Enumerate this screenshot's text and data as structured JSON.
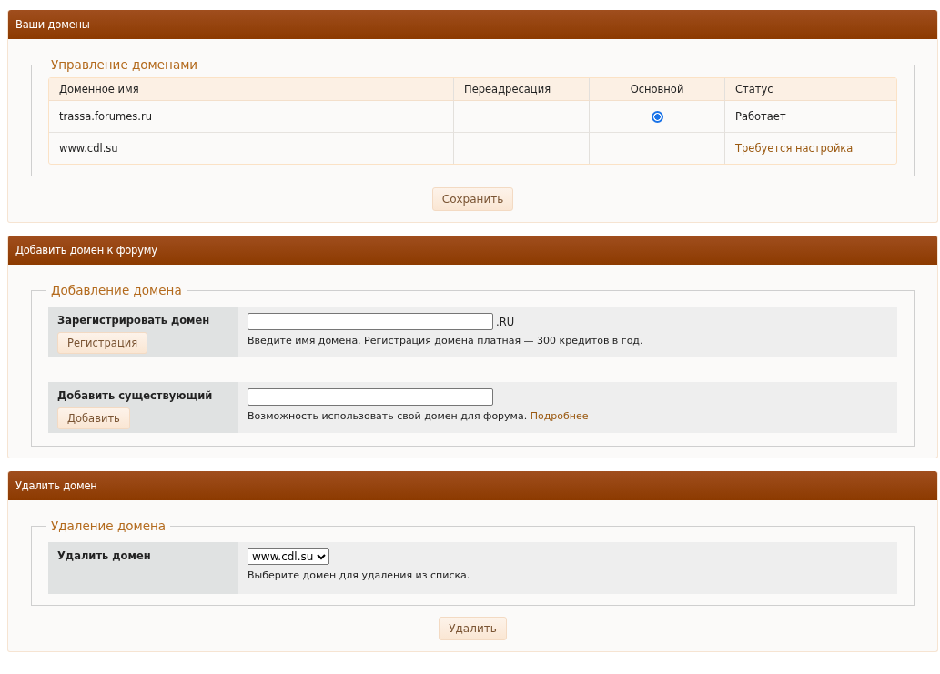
{
  "domains_panel": {
    "title": "Ваши домены",
    "legend": "Управление доменами",
    "columns": [
      "Доменное имя",
      "Переадресация",
      "Основной",
      "Статус"
    ],
    "rows": [
      {
        "domain": "trassa.forumes.ru",
        "primary": true,
        "status": "Работает",
        "kind": "ok"
      },
      {
        "domain": "www.cdl.su",
        "primary": false,
        "status": "Требуется настройка",
        "kind": "warning"
      }
    ],
    "save_button": "Сохранить"
  },
  "add_panel": {
    "title": "Добавить домен к форуму",
    "legend": "Добавление домена",
    "rows": [
      {
        "label": "Зарегистрировать домен",
        "button": "Регистрация",
        "suffix": ".RU",
        "hint": "Введите имя домена. Регистрация домена платная — 300 кредитов в год."
      },
      {
        "label": "Добавить существующий",
        "button": "Добавить",
        "hint": "Возможность использовать свой домен для форума.",
        "link": "Подробнее"
      }
    ]
  },
  "delete_panel": {
    "title": "Удалить домен",
    "legend": "Удаление домена",
    "label": "Удалить домен",
    "select_value": "www.cdl.su",
    "hint": "Выберите домен для удаления из списка.",
    "delete_button": "Удалить"
  }
}
